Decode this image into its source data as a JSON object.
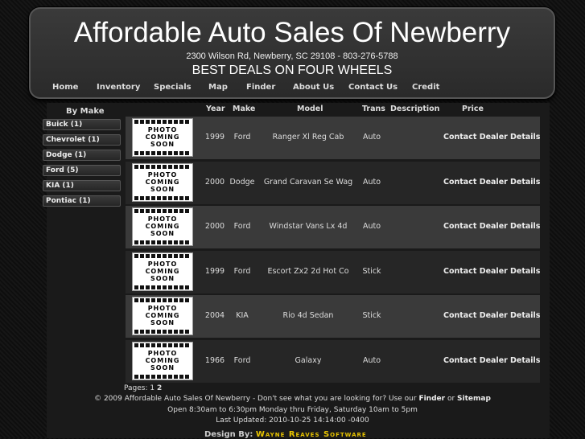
{
  "header": {
    "title": "Affordable Auto Sales Of Newberry",
    "address": "2300 Wilson Rd, Newberry, SC 29108 - 803-276-5788",
    "tagline": "BEST DEALS ON FOUR WHEELS"
  },
  "nav": [
    "Home",
    "Inventory",
    "Specials",
    "Map",
    "Finder",
    "About Us",
    "Contact Us",
    "Credit"
  ],
  "sidebar": {
    "title": "By Make",
    "makes": [
      "Buick (1)",
      "Chevrolet (1)",
      "Dodge (1)",
      "Ford (5)",
      "KIA (1)",
      "Pontiac (1)"
    ]
  },
  "table": {
    "headers": [
      "Year",
      "Make",
      "Model",
      "Trans",
      "Description",
      "Price"
    ],
    "thumb_text": "PHOTO COMING SOON",
    "contact_label": "Contact Dealer",
    "details_label": "Details",
    "rows": [
      {
        "year": "1999",
        "make": "Ford",
        "model": "Ranger Xl Reg Cab",
        "trans": "Auto"
      },
      {
        "year": "2000",
        "make": "Dodge",
        "model": "Grand Caravan Se Wag",
        "trans": "Auto"
      },
      {
        "year": "2000",
        "make": "Ford",
        "model": "Windstar Vans Lx 4d",
        "trans": "Auto"
      },
      {
        "year": "1999",
        "make": "Ford",
        "model": "Escort Zx2 2d Hot Co",
        "trans": "Stick"
      },
      {
        "year": "2004",
        "make": "KIA",
        "model": "Rio 4d Sedan",
        "trans": "Stick"
      },
      {
        "year": "1966",
        "make": "Ford",
        "model": "Galaxy",
        "trans": "Auto"
      }
    ]
  },
  "pages": {
    "label": "Pages:",
    "current": "1",
    "next": "2"
  },
  "footer": {
    "copyright": "© 2009 Affordable Auto Sales Of Newberry - Don't see what you are looking for? Use our",
    "finder_link": "Finder",
    "or": "or",
    "sitemap_link": "Sitemap",
    "hours": "Open 8:30am to 6:30pm Monday thru Friday, Saturday 10am to 5pm",
    "updated": "Last Updated: 2010-10-25 14:14:00 -0400",
    "credit_prefix": "Design By:",
    "credit_brand": "Wayne Reaves Software"
  }
}
